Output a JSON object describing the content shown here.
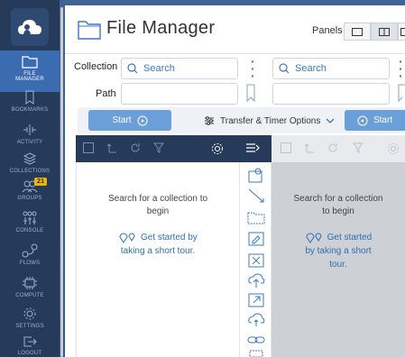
{
  "sidebar": {
    "items": [
      {
        "label1": "FILE",
        "label2": "MANAGER"
      },
      {
        "label1": "BOOKMARKS",
        "label2": ""
      },
      {
        "label1": "ACTIVITY",
        "label2": ""
      },
      {
        "label1": "COLLECTIONS",
        "label2": ""
      },
      {
        "label1": "GROUPS",
        "label2": "",
        "badge": "21"
      },
      {
        "label1": "CONSOLE",
        "label2": ""
      },
      {
        "label1": "FLOWS",
        "label2": ""
      },
      {
        "label1": "COMPUTE",
        "label2": ""
      },
      {
        "label1": "SETTINGS",
        "label2": ""
      },
      {
        "label1": "LOGOUT",
        "label2": ""
      }
    ]
  },
  "header": {
    "title": "File Manager",
    "panels_label": "Panels"
  },
  "form": {
    "collection_label": "Collection",
    "path_label": "Path",
    "search_placeholder_left": "Search",
    "search_placeholder_right": "Search"
  },
  "toolbar": {
    "start_left": "Start",
    "transfer_options": "Transfer & Timer Options",
    "start_right": "Start"
  },
  "left_pane": {
    "empty_line1": "Search for a collection to",
    "empty_line2": "begin",
    "tour_line1": "Get started by",
    "tour_line2": "taking a short tour."
  },
  "right_pane": {
    "empty_line1": "Search for a collection",
    "empty_line2": "to begin",
    "tour_line1": "Get started",
    "tour_line2": "by taking a short",
    "tour_line3": "tour."
  },
  "colors": {
    "sidebar": "#263a59",
    "active": "#3b6bb0",
    "accent": "#3a78c3",
    "badge": "#f2b400"
  }
}
